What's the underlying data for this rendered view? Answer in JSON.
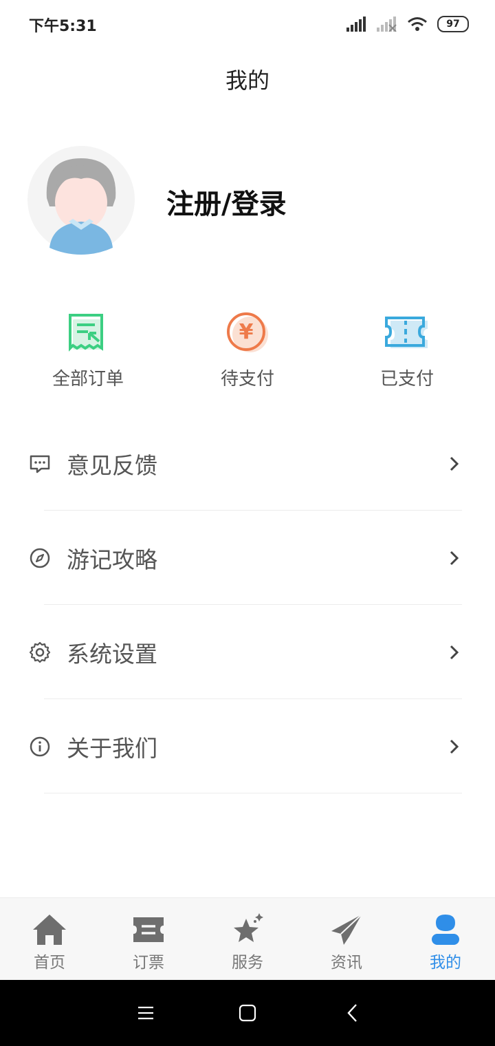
{
  "status_bar": {
    "time": "下午5:31",
    "battery": "97"
  },
  "header": {
    "title": "我的"
  },
  "profile": {
    "login_label": "注册/登录"
  },
  "orders": [
    {
      "label": "全部订单",
      "icon": "receipt-icon",
      "color": "#3ccf82"
    },
    {
      "label": "待支付",
      "icon": "yuan-coin-icon",
      "color": "#ee7a4a"
    },
    {
      "label": "已支付",
      "icon": "ticket-icon",
      "color": "#3aa9dd"
    }
  ],
  "menu": [
    {
      "label": "意见反馈",
      "icon": "feedback-chat-icon"
    },
    {
      "label": "游记攻略",
      "icon": "compass-icon"
    },
    {
      "label": "系统设置",
      "icon": "gear-icon"
    },
    {
      "label": "关于我们",
      "icon": "info-icon"
    }
  ],
  "tabs": [
    {
      "label": "首页",
      "icon": "home-icon"
    },
    {
      "label": "订票",
      "icon": "ticket-icon"
    },
    {
      "label": "服务",
      "icon": "star-icon"
    },
    {
      "label": "资讯",
      "icon": "paper-plane-icon"
    },
    {
      "label": "我的",
      "icon": "person-icon",
      "active": true
    }
  ],
  "colors": {
    "accent": "#2f8ee8",
    "tab_inactive": "#777777"
  }
}
